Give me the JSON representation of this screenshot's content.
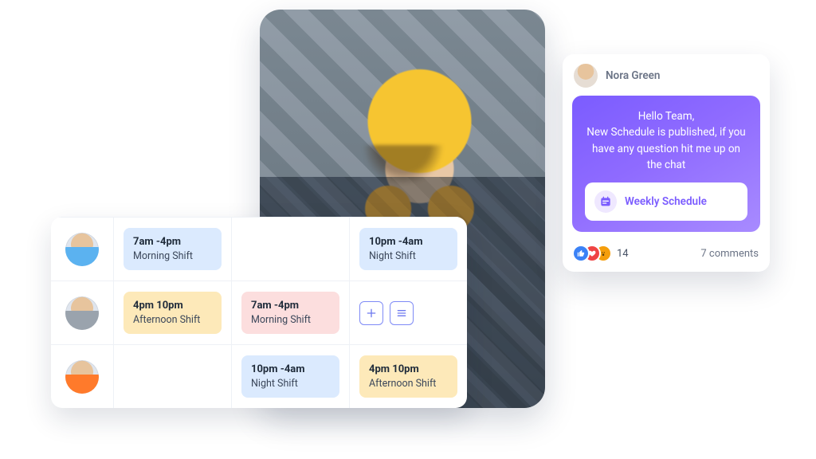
{
  "hero": {
    "alt": "Smiling construction worker with yellow hard hat and ear protection"
  },
  "schedule": {
    "rows": [
      {
        "avatar": "worker-1",
        "cells": [
          {
            "kind": "blue",
            "time": "7am -4pm",
            "label": "Morning Shift"
          },
          {
            "kind": "empty"
          },
          {
            "kind": "blue",
            "time": "10pm -4am",
            "label": "Night Shift"
          }
        ]
      },
      {
        "avatar": "worker-2",
        "cells": [
          {
            "kind": "yellow",
            "time": "4pm 10pm",
            "label": "Afternoon Shift"
          },
          {
            "kind": "pink",
            "time": "7am -4pm",
            "label": "Morning Shift"
          },
          {
            "kind": "actions"
          }
        ]
      },
      {
        "avatar": "worker-3",
        "cells": [
          {
            "kind": "empty"
          },
          {
            "kind": "blue",
            "time": "10pm -4am",
            "label": "Night Shift"
          },
          {
            "kind": "yellow",
            "time": "4pm 10pm",
            "label": "Afternoon Shift"
          }
        ]
      }
    ],
    "actions": {
      "add_label": "+",
      "list_label": "≡"
    }
  },
  "message": {
    "author": "Nora Green",
    "body": "Hello Team,\nNew Schedule is published, if you have any question hit me up on the chat",
    "attachment": {
      "label": "Weekly Schedule"
    },
    "reactions_count": "14",
    "comments_label": "7 comments"
  }
}
